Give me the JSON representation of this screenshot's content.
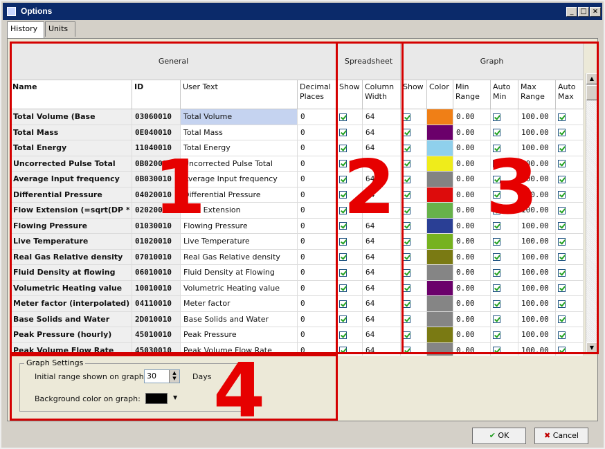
{
  "window": {
    "title": "Options"
  },
  "tabs": [
    {
      "label": "History"
    },
    {
      "label": "Units"
    }
  ],
  "groups": {
    "general": "General",
    "spreadsheet": "Spreadsheet",
    "graph": "Graph"
  },
  "columns": {
    "name": "Name",
    "id": "ID",
    "user_text": "User Text",
    "decimal": "Decimal Places",
    "show": "Show",
    "col_width": "Column Width",
    "g_show": "Show",
    "color": "Color",
    "min_range": "Min Range",
    "auto_min": "Auto Min",
    "max_range": "Max Range",
    "auto_max": "Auto Max"
  },
  "rows": [
    {
      "name": "Total Volume (Base",
      "id": "03060010",
      "user_text": "Total Volume",
      "decimal": "0",
      "width": "64",
      "color": "#f07f16",
      "min": "0.00",
      "max": "100.00"
    },
    {
      "name": "Total Mass",
      "id": "0E040010",
      "user_text": "Total Mass",
      "decimal": "0",
      "width": "64",
      "color": "#6b006b",
      "min": "0.00",
      "max": "100.00"
    },
    {
      "name": "Total Energy",
      "id": "11040010",
      "user_text": "Total Energy",
      "decimal": "0",
      "width": "64",
      "color": "#8fd0ec",
      "min": "0.00",
      "max": "100.00"
    },
    {
      "name": "Uncorrected Pulse Total",
      "id": "0B020010",
      "user_text": "Uncorrected Pulse Total",
      "decimal": "0",
      "width": "64",
      "color": "#efec1b",
      "min": "0.00",
      "max": "100.00"
    },
    {
      "name": "Average Input frequency",
      "id": "0B030010",
      "user_text": "Average Input frequency",
      "decimal": "0",
      "width": "64",
      "color": "#838383",
      "min": "0.00",
      "max": "100.00"
    },
    {
      "name": "Differential Pressure",
      "id": "04020010",
      "user_text": "Differential Pressure",
      "decimal": "0",
      "width": "64",
      "color": "#dd0c0c",
      "min": "0.00",
      "max": "100.00"
    },
    {
      "name": "Flow Extension (=sqrt(DP *",
      "id": "02020010",
      "user_text": "Flow Extension",
      "decimal": "0",
      "width": "64",
      "color": "#67b24a",
      "min": "0.00",
      "max": "100.00"
    },
    {
      "name": "Flowing Pressure",
      "id": "01030010",
      "user_text": "Flowing Pressure",
      "decimal": "0",
      "width": "64",
      "color": "#2a3f95",
      "min": "0.00",
      "max": "100.00"
    },
    {
      "name": "Live Temperature",
      "id": "01020010",
      "user_text": "Live Temperature",
      "decimal": "0",
      "width": "64",
      "color": "#76b21f",
      "min": "0.00",
      "max": "100.00"
    },
    {
      "name": "Real Gas Relative density",
      "id": "07010010",
      "user_text": "Real Gas Relative density",
      "decimal": "0",
      "width": "64",
      "color": "#7a7a13",
      "min": "0.00",
      "max": "100.00"
    },
    {
      "name": "Fluid Density at flowing",
      "id": "06010010",
      "user_text": "Fluid Density at Flowing",
      "decimal": "0",
      "width": "64",
      "color": "#858585",
      "min": "0.00",
      "max": "100.00"
    },
    {
      "name": "Volumetric Heating value",
      "id": "10010010",
      "user_text": "Volumetric Heating value",
      "decimal": "0",
      "width": "64",
      "color": "#6b006b",
      "min": "0.00",
      "max": "100.00"
    },
    {
      "name": "Meter factor (interpolated)",
      "id": "04110010",
      "user_text": "Meter factor",
      "decimal": "0",
      "width": "64",
      "color": "#858585",
      "min": "0.00",
      "max": "100.00"
    },
    {
      "name": "Base Solids and Water",
      "id": "2D010010",
      "user_text": "Base Solids and Water",
      "decimal": "0",
      "width": "64",
      "color": "#858585",
      "min": "0.00",
      "max": "100.00"
    },
    {
      "name": "Peak Pressure (hourly)",
      "id": "45010010",
      "user_text": "Peak Pressure",
      "decimal": "0",
      "width": "64",
      "color": "#7a7a13",
      "min": "0.00",
      "max": "100.00"
    },
    {
      "name": "Peak Volume Flow Rate",
      "id": "45030010",
      "user_text": "Peak Volume Flow Rate",
      "decimal": "0",
      "width": "64",
      "color": "#858585",
      "min": "0.00",
      "max": "100.00"
    }
  ],
  "graph_settings": {
    "legend": "Graph Settings",
    "initial_range_label": "Initial range shown on graph:",
    "initial_range_value": "30",
    "days_label": "Days",
    "bg_color_label": "Background color on graph:",
    "bg_color": "#000000"
  },
  "annotations": [
    "1",
    "2",
    "3",
    "4"
  ],
  "buttons": {
    "ok": "OK",
    "cancel": "Cancel"
  }
}
